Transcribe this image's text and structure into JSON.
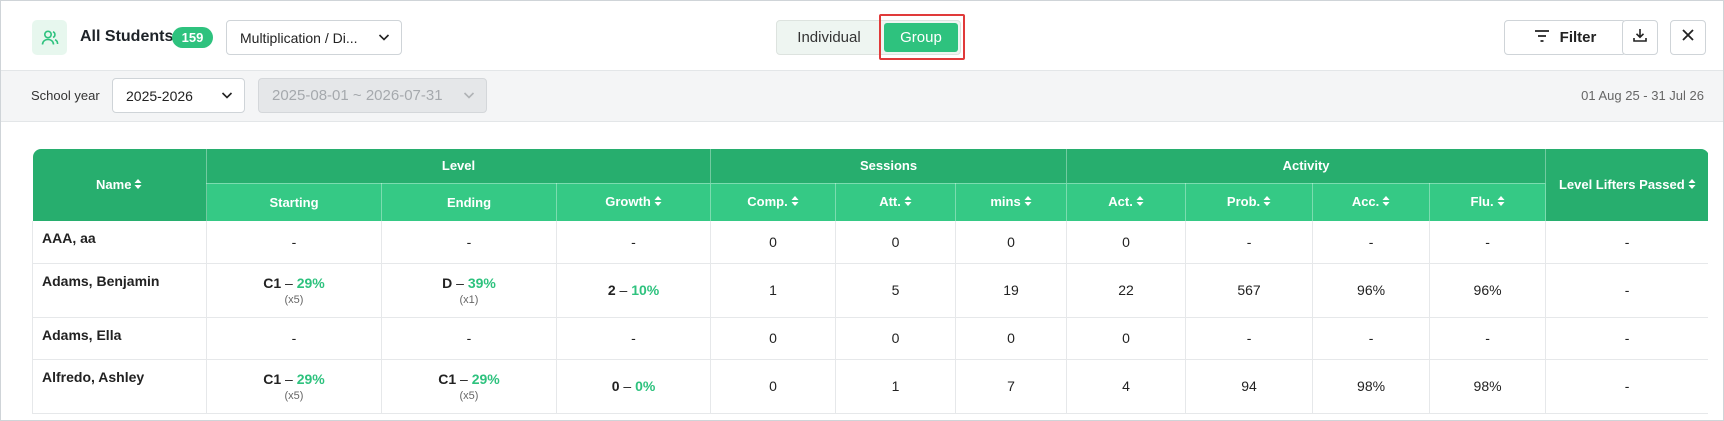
{
  "header": {
    "title": "All Students",
    "count": "159",
    "skill_select": "Multiplication / Di...",
    "toggle": {
      "individual": "Individual",
      "group": "Group",
      "active": "group"
    },
    "filter_label": "Filter"
  },
  "filters": {
    "school_year_label": "School year",
    "school_year": "2025-2026",
    "date_range_select": "2025-08-01 ~ 2026-07-31",
    "date_range_text": "01 Aug 25 - 31 Jul 26"
  },
  "table": {
    "groups": {
      "level": "Level",
      "sessions": "Sessions",
      "activity": "Activity"
    },
    "columns": {
      "name": "Name",
      "starting": "Starting",
      "ending": "Ending",
      "growth": "Growth",
      "comp": "Comp.",
      "att": "Att.",
      "mins": "mins",
      "act": "Act.",
      "prob": "Prob.",
      "acc": "Acc.",
      "flu": "Flu.",
      "level_lifters": "Level Lifters Passed"
    },
    "rows": [
      {
        "name": "AAA, aa",
        "starting": "-",
        "ending": "-",
        "growth": "-",
        "comp": "0",
        "att": "0",
        "mins": "0",
        "act": "0",
        "prob": "-",
        "acc": "-",
        "flu": "-",
        "lifters": "-"
      },
      {
        "name": "Adams, Benjamin",
        "starting_level": "C1",
        "starting_pct": "29%",
        "starting_mult": "(x5)",
        "ending_level": "D",
        "ending_pct": "39%",
        "ending_mult": "(x1)",
        "growth_level": "2",
        "growth_pct": "10%",
        "comp": "1",
        "att": "5",
        "mins": "19",
        "act": "22",
        "prob": "567",
        "acc": "96%",
        "flu": "96%",
        "lifters": "-"
      },
      {
        "name": "Adams, Ella",
        "starting": "-",
        "ending": "-",
        "growth": "-",
        "comp": "0",
        "att": "0",
        "mins": "0",
        "act": "0",
        "prob": "-",
        "acc": "-",
        "flu": "-",
        "lifters": "-"
      },
      {
        "name": "Alfredo, Ashley",
        "starting_level": "C1",
        "starting_pct": "29%",
        "starting_mult": "(x5)",
        "ending_level": "C1",
        "ending_pct": "29%",
        "ending_mult": "(x5)",
        "growth_level": "0",
        "growth_pct": "0%",
        "comp": "0",
        "att": "1",
        "mins": "7",
        "act": "4",
        "prob": "94",
        "acc": "98%",
        "flu": "98%",
        "lifters": "-"
      }
    ]
  },
  "colors": {
    "accent": "#2ec27e",
    "header_dark": "#27ae6e",
    "header_light": "#35c985",
    "highlight": "#e03a3a"
  },
  "icons": {
    "students": "students-icon",
    "chevron": "chevron-down-icon",
    "filter": "filter-icon",
    "download": "download-icon",
    "close": "close-icon",
    "sort": "sort-icon"
  }
}
